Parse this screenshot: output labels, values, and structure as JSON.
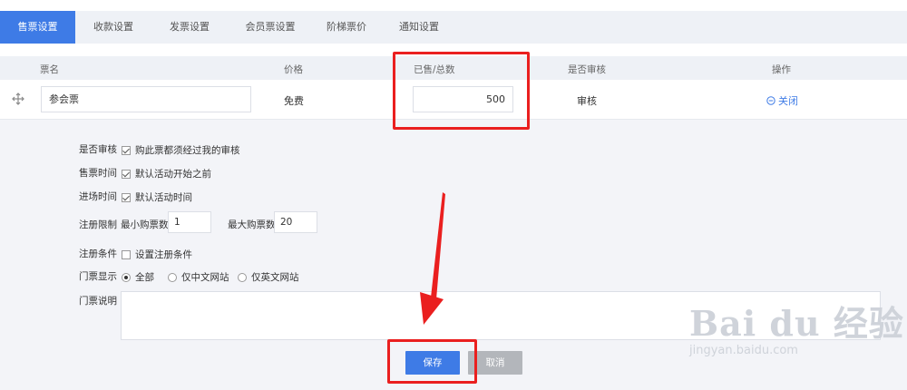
{
  "tabs": [
    "售票设置",
    "收款设置",
    "发票设置",
    "会员票设置",
    "阶梯票价",
    "通知设置"
  ],
  "table": {
    "headers": [
      "票名",
      "价格",
      "已售/总数",
      "是否审核",
      "操作"
    ],
    "row": {
      "name": "参会票",
      "price": "免费",
      "count": "500",
      "audit": "审核",
      "action": "关闭"
    }
  },
  "form": {
    "audit": {
      "label": "是否审核",
      "option": "购此票都须经过我的审核",
      "checked": true
    },
    "sale_time": {
      "label": "售票时间",
      "option": "默认活动开始之前",
      "checked": true
    },
    "entry_time": {
      "label": "进场时间",
      "option": "默认活动时间",
      "checked": true
    },
    "limit": {
      "label": "注册限制",
      "min_label": "最小购票数",
      "min_value": "1",
      "max_label": "最大购票数",
      "max_value": "20"
    },
    "condition": {
      "label": "注册条件",
      "option": "设置注册条件",
      "checked": false
    },
    "display": {
      "label": "门票显示",
      "options": [
        "全部",
        "仅中文网站",
        "仅英文网站"
      ],
      "selected": "全部"
    },
    "description": {
      "label": "门票说明",
      "value": ""
    }
  },
  "buttons": {
    "save": "保存",
    "cancel": "取消"
  },
  "watermark": {
    "logo": "Bai du 经验",
    "url": "jingyan.baidu.com"
  },
  "colors": {
    "accent": "#3e7be6",
    "annotation": "#ea1f1f"
  }
}
